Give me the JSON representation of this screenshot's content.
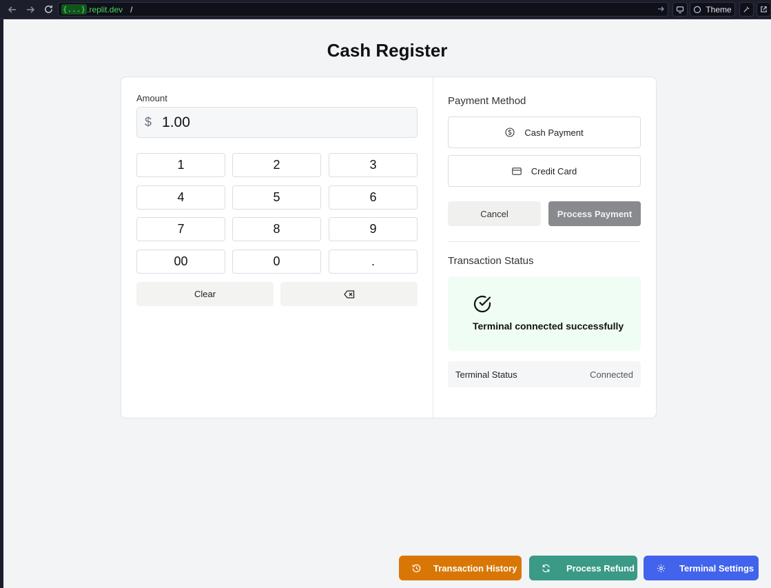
{
  "browser": {
    "url_badge": "{...}",
    "url_domain": ".replit.dev",
    "url_path": "/",
    "theme_label": "Theme"
  },
  "page": {
    "title": "Cash Register"
  },
  "amount": {
    "label": "Amount",
    "currency_symbol": "$",
    "value": "1.00"
  },
  "keypad": {
    "keys": [
      "1",
      "2",
      "3",
      "4",
      "5",
      "6",
      "7",
      "8",
      "9",
      "00",
      "0",
      "."
    ],
    "clear_label": "Clear"
  },
  "payment": {
    "section_title": "Payment Method",
    "cash_label": "Cash Payment",
    "card_label": "Credit Card",
    "cancel_label": "Cancel",
    "process_label": "Process Payment"
  },
  "transaction": {
    "section_title": "Transaction Status",
    "message": "Terminal connected successfully",
    "terminal_status_label": "Terminal Status",
    "terminal_status_value": "Connected"
  },
  "actions": {
    "history_label": "Transaction History",
    "refund_label": "Process Refund",
    "settings_label": "Terminal Settings"
  },
  "colors": {
    "history": "#d97706",
    "refund": "#3a9a86",
    "settings": "#4263eb",
    "status_bg": "#f0fdf4"
  }
}
